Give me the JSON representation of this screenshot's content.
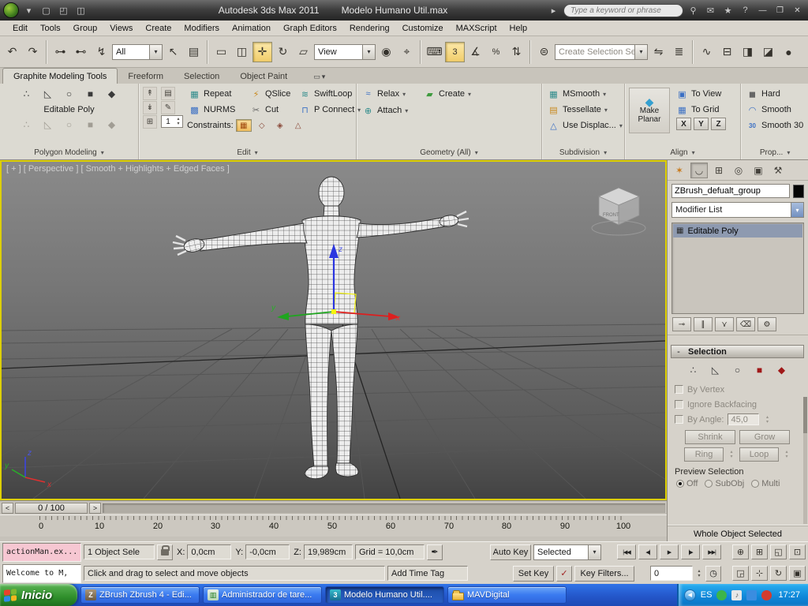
{
  "titlebar": {
    "app_title": "Autodesk 3ds Max  2011",
    "doc_title": "Modelo Humano Util.max",
    "search_placeholder": "Type a keyword or phrase"
  },
  "menus": [
    "Edit",
    "Tools",
    "Group",
    "Views",
    "Create",
    "Modifiers",
    "Animation",
    "Graph Editors",
    "Rendering",
    "Customize",
    "MAXScript",
    "Help"
  ],
  "toolbar": {
    "filter_value": "All",
    "coord_value": "View",
    "selset_placeholder": "Create Selection Se"
  },
  "ribbon": {
    "tabs": [
      "Graphite Modeling Tools",
      "Freeform",
      "Selection",
      "Object Paint"
    ],
    "poly": {
      "object": "Editable Poly",
      "caption": "Polygon Modeling"
    },
    "edit": {
      "caption": "Edit",
      "b_repeat": "Repeat",
      "b_qslice": "QSlice",
      "b_swiftloop": "SwiftLoop",
      "b_nurms": "NURMS",
      "b_cut": "Cut",
      "b_pconnect": "P Connect",
      "constraints": "Constraints:",
      "spinner": "1"
    },
    "geom": {
      "caption": "Geometry (All)",
      "b_relax": "Relax",
      "b_create": "Create",
      "b_attach": "Attach"
    },
    "subdiv": {
      "caption": "Subdivision",
      "b_msmooth": "MSmooth",
      "b_tessellate": "Tessellate",
      "b_displace": "Use Displac..."
    },
    "align": {
      "caption": "Align",
      "b_makeplanar": "Make Planar",
      "b_toview": "To View",
      "b_togrid": "To Grid",
      "b_x": "X",
      "b_y": "Y",
      "b_z": "Z"
    },
    "props": {
      "caption": "Prop...",
      "b_hard": "Hard",
      "b_smooth": "Smooth",
      "b_smooth30": "Smooth 30",
      "badge30": "30"
    }
  },
  "viewport": {
    "label": "[ + ] [ Perspective ] [ Smooth + Highlights + Edged Faces ]",
    "cube_label": "FRONT",
    "axis": {
      "x": "x",
      "y": "y",
      "z": "z"
    }
  },
  "cmdpanel": {
    "object_name": "ZBrush_defualt_group",
    "modifier_list": "Modifier List",
    "stack": [
      {
        "label": "Editable Poly"
      }
    ],
    "selection": {
      "title": "Selection",
      "by_vertex": "By Vertex",
      "ignore_backfacing": "Ignore Backfacing",
      "by_angle": "By Angle:",
      "by_angle_value": "45,0",
      "shrink": "Shrink",
      "grow": "Grow",
      "ring": "Ring",
      "loop": "Loop",
      "preview": "Preview Selection",
      "off": "Off",
      "subobj": "SubObj",
      "multi": "Multi"
    },
    "status": "Whole Object Selected"
  },
  "timeline": {
    "slider": "0 / 100",
    "prev": "<",
    "next": ">",
    "ticks": [
      "0",
      "10",
      "20",
      "30",
      "40",
      "50",
      "60",
      "70",
      "80",
      "90",
      "100"
    ]
  },
  "statusbar": {
    "listener1": "actionMan.ex...",
    "listener2": "Welcome to M,",
    "selection": "1 Object Sele",
    "x": "X:",
    "xv": "0,0cm",
    "y": "Y:",
    "yv": "-0,0cm",
    "z": "Z:",
    "zv": "19,989cm",
    "grid": "Grid = 10,0cm",
    "prompt": "Click and drag to select and move objects",
    "add_time_tag": "Add Time Tag",
    "auto_key": "Auto Key",
    "set_key": "Set Key",
    "sel_mode": "Selected",
    "key_filters": "Key Filters...",
    "frame": "0"
  },
  "taskbar": {
    "start": "Inicio",
    "tasks": [
      {
        "label": "ZBrush Zbrush 4 - Edi..."
      },
      {
        "label": "Administrador de tare..."
      },
      {
        "label": "Modelo Humano Util...."
      },
      {
        "label": "MAVDigital"
      }
    ],
    "lang": "ES",
    "time": "17:27"
  },
  "colors": {
    "active_tool_yellow": "#f1cd6b",
    "viewport_border_yellow": "#ddcf00",
    "taskbar_blue": "#2457ca",
    "start_green": "#2f8f2b",
    "gizmo_x_red": "#dd1f1f",
    "gizmo_y_green": "#1fa51f",
    "gizmo_z_blue": "#2b35e0",
    "listener_pink": "#f6c7d2",
    "stack_selected": "#8e9ab0"
  },
  "icons": {
    "caret": "▾",
    "minus": "-",
    "expand": "▸",
    "new": "▢",
    "open": "◰",
    "save": "◫",
    "search": "⚲",
    "comm": "✉",
    "fav": "★",
    "help": "?",
    "win_min": "—",
    "win_max": "❐",
    "win_close": "✕",
    "undo": "↶",
    "redo": "↷",
    "link": "⊶",
    "unlink": "⊷",
    "bind": "↯",
    "select": "↖",
    "by_name": "▤",
    "region": "▭",
    "crossing": "◫",
    "move": "✛",
    "rotate": "↻",
    "scale": "▱",
    "pivot": "◉",
    "manip": "⌖",
    "kbd": "⌨",
    "snap": "3",
    "snap_angle": "∡",
    "snap_pct": "%",
    "snap_spin": "⇅",
    "selsets": "⊜",
    "mirror": "⇋",
    "align": "≣",
    "curve": "∿",
    "schem": "⊟",
    "mtl": "◨",
    "rset": "◪",
    "render": "●",
    "min_ribbon": "▭",
    "mc1": "↟",
    "mc2": "↡",
    "mc3": "⊞",
    "mc4": "▤",
    "mc5": "✎",
    "rib_repeat": "▦",
    "rib_qslice": "⚡",
    "rib_swift": "≋",
    "rib_nurms": "▩",
    "rib_cut": "✂",
    "rib_pconnect": "⊓",
    "con1": "▦",
    "con2": "◇",
    "con3": "◈",
    "con4": "△",
    "rib_relax": "≈",
    "rib_create": "▰",
    "rib_attach": "⊕",
    "rib_msmooth": "▦",
    "rib_tess": "▤",
    "rib_disp": "△",
    "rib_planar": "◆",
    "rib_toview": "▣",
    "rib_togrid": "▦",
    "rib_hard": "◼",
    "rib_smooth": "◠",
    "cp_create": "✶",
    "cp_modify": "◡",
    "cp_hier": "⊞",
    "cp_motion": "◎",
    "cp_disp": "▣",
    "cp_util": "⚒",
    "stack_item": "▦",
    "pin": "⊸",
    "endres": "∥",
    "unique": "⋎",
    "remove": "⌫",
    "config": "⚙",
    "vertex": "∴",
    "edge": "◺",
    "border": "○",
    "polygon": "■",
    "element": "◆",
    "spin_up": "▴",
    "spin_down": "▾",
    "pen": "✒",
    "check": "✓",
    "clock": "◷",
    "tr_start": "|◀◀",
    "tr_prev": "◀|",
    "tr_play": "▶",
    "tr_next": "|▶",
    "tr_end": "▶▶|",
    "nav_zoom": "⊕",
    "nav_zoomall": "⊞",
    "nav_ext": "◱",
    "nav_extall": "⊡",
    "nav_region": "◲",
    "nav_pan": "⊹",
    "nav_orbit": "↻",
    "nav_max": "▣",
    "chev": "◀",
    "note": "♪",
    "task_z": "Z",
    "task_tm": "▥",
    "task_mx": "3"
  }
}
